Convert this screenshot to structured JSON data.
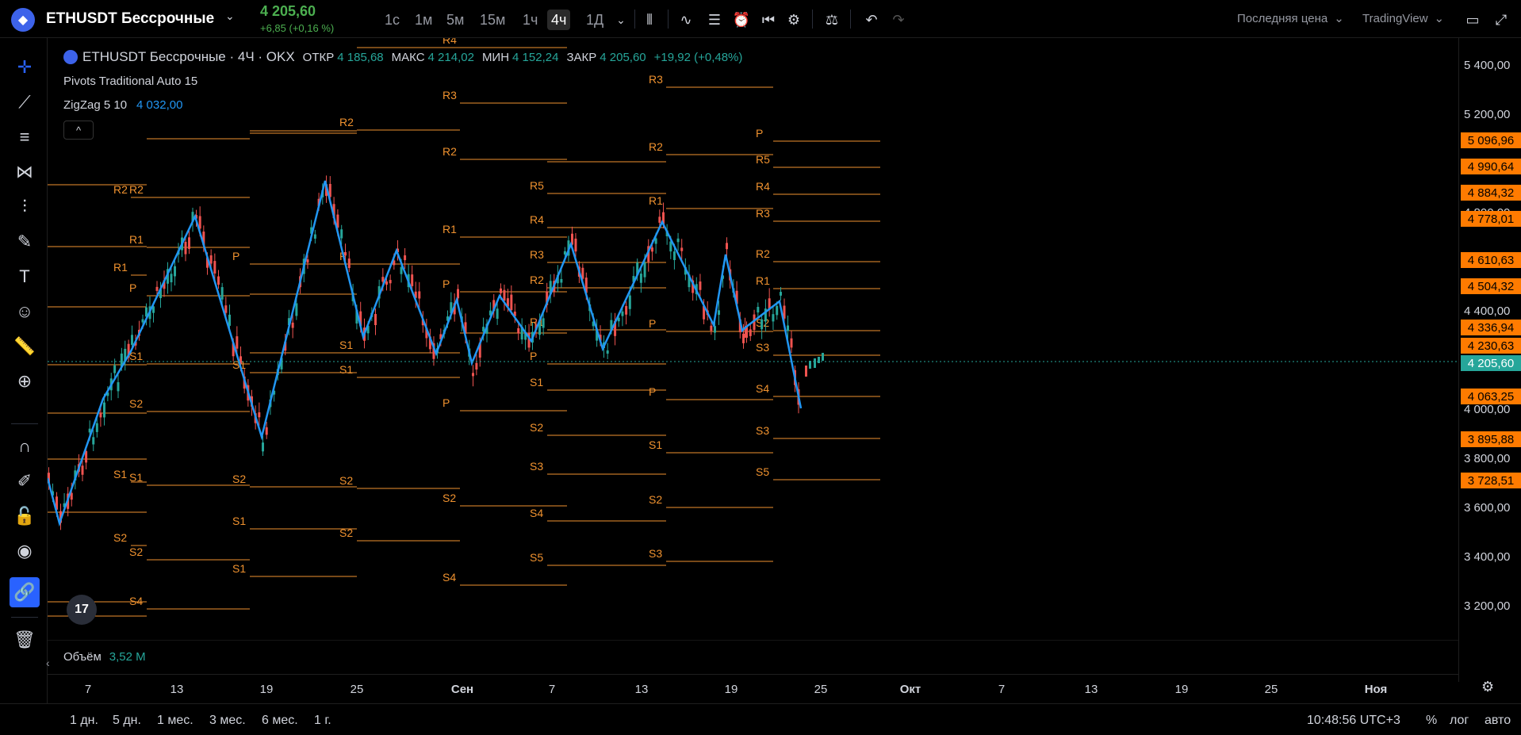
{
  "symbol": {
    "name": "ETHUSDT Бессрочные",
    "price": "4 205,60",
    "change": "+6,85 (+0,16 %)"
  },
  "timeframes": [
    "1с",
    "1м",
    "5м",
    "15м",
    "1ч",
    "4ч",
    "1Д"
  ],
  "active_timeframe": "4ч",
  "top_right": {
    "price_type": "Последняя цена",
    "brand": "TradingView"
  },
  "legend": {
    "title": "ETHUSDT Бессрочные · 4Ч · OKX",
    "open_label": "ОТКР",
    "open": "4 185,68",
    "high_label": "МАКС",
    "high": "4 214,02",
    "low_label": "МИН",
    "low": "4 152,24",
    "close_label": "ЗАКР",
    "close": "4 205,60",
    "delta": "+19,92 (+0,48%)",
    "indicator1": "Pivots Traditional Auto 15",
    "indicator2": "ZigZag 5 10",
    "indicator2_value": "4 032,00",
    "volume_label": "Объём",
    "volume_value": "3,52 M"
  },
  "price_axis": {
    "ticks": [
      "5 400,00",
      "5 200,00",
      "4 800,00",
      "4 400,00",
      "4 000,00",
      "3 800,00",
      "3 600,00",
      "3 400,00",
      "3 200,00"
    ],
    "badges": [
      "5 096,96",
      "4 990,64",
      "4 884,32",
      "4 778,01",
      "4 610,63",
      "4 504,32",
      "4 336,94",
      "4 230,63",
      "4 063,25",
      "3 895,88",
      "3 728,51"
    ],
    "current": "4 205,60"
  },
  "time_axis": [
    "7",
    "13",
    "19",
    "25",
    "Сен",
    "7",
    "13",
    "19",
    "25",
    "Окт",
    "7",
    "13",
    "19",
    "25",
    "Ноя"
  ],
  "ranges": [
    "1 дн.",
    "5 дн.",
    "1 мес.",
    "3 мес.",
    "6 мес.",
    "1 г."
  ],
  "bottom_right": {
    "clock": "10:48:56 UTC+3",
    "percent": "%",
    "log": "лог",
    "auto": "авто"
  },
  "pivot_labels": [
    "R1",
    "R2",
    "P",
    "S1",
    "S2",
    "R1",
    "R2",
    "P",
    "S1",
    "S2",
    "S3",
    "S4",
    "R1",
    "R2",
    "P",
    "S1",
    "S2",
    "S3",
    "R3",
    "R4",
    "P",
    "S1",
    "S2",
    "S3",
    "S4",
    "P",
    "R1",
    "R2",
    "R3",
    "R4",
    "R5",
    "S1",
    "S2",
    "S3",
    "S4",
    "S5",
    "R1",
    "R2",
    "R3",
    "P",
    "S1",
    "S2",
    "S3",
    "S4",
    "S5",
    "R1",
    "R2",
    "R3",
    "R4",
    "R5",
    "P",
    "S1",
    "S2",
    "S3",
    "S4",
    "S5"
  ],
  "colors": {
    "up": "#26a69a",
    "down": "#ef5350",
    "zigzag": "#2196f3",
    "pivot": "#f0922f",
    "badge": "#ff7b00"
  }
}
